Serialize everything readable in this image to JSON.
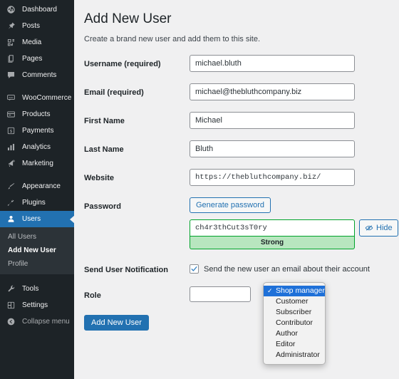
{
  "sidebar": {
    "items": [
      {
        "label": "Dashboard",
        "icon": "dashboard-icon",
        "current": false
      },
      {
        "label": "Posts",
        "icon": "pin-icon",
        "current": false
      },
      {
        "label": "Media",
        "icon": "media-icon",
        "current": false
      },
      {
        "label": "Pages",
        "icon": "pages-icon",
        "current": false
      },
      {
        "label": "Comments",
        "icon": "comments-icon",
        "current": false
      },
      {
        "label": "WooCommerce",
        "icon": "woocommerce-icon",
        "current": false
      },
      {
        "label": "Products",
        "icon": "products-icon",
        "current": false
      },
      {
        "label": "Payments",
        "icon": "payments-icon",
        "current": false
      },
      {
        "label": "Analytics",
        "icon": "analytics-icon",
        "current": false
      },
      {
        "label": "Marketing",
        "icon": "marketing-icon",
        "current": false
      },
      {
        "label": "Appearance",
        "icon": "appearance-icon",
        "current": false
      },
      {
        "label": "Plugins",
        "icon": "plugins-icon",
        "current": false
      },
      {
        "label": "Users",
        "icon": "users-icon",
        "current": true
      },
      {
        "label": "Tools",
        "icon": "tools-icon",
        "current": false
      },
      {
        "label": "Settings",
        "icon": "settings-icon",
        "current": false
      },
      {
        "label": "Collapse menu",
        "icon": "collapse-icon",
        "current": false
      }
    ],
    "submenu": [
      {
        "label": "All Users",
        "current": false
      },
      {
        "label": "Add New User",
        "current": true
      },
      {
        "label": "Profile",
        "current": false
      }
    ]
  },
  "page": {
    "title": "Add New User",
    "description": "Create a brand new user and add them to this site."
  },
  "form": {
    "username": {
      "label": "Username (required)",
      "value": "michael.bluth"
    },
    "email": {
      "label": "Email (required)",
      "value": "michael@thebluthcompany.biz"
    },
    "first_name": {
      "label": "First Name",
      "value": "Michael"
    },
    "last_name": {
      "label": "Last Name",
      "value": "Bluth"
    },
    "website": {
      "label": "Website",
      "value": "https://thebluthcompany.biz/"
    },
    "password": {
      "label": "Password",
      "generate_label": "Generate password",
      "value": "ch4r3thCut3sT0ry",
      "hide_label": "Hide",
      "strength": "Strong"
    },
    "notification": {
      "label": "Send User Notification",
      "checkbox_label": "Send the new user an email about their account",
      "checked": true
    },
    "role": {
      "label": "Role",
      "selected": "Shop manager",
      "options": [
        "Shop manager",
        "Customer",
        "Subscriber",
        "Contributor",
        "Author",
        "Editor",
        "Administrator"
      ]
    },
    "submit_label": "Add New User"
  },
  "colors": {
    "admin_blue": "#2271b1",
    "sidebar_bg": "#1d2327",
    "submenu_bg": "#2c3338",
    "strength_green": "#b8e6bf",
    "strength_border": "#00a32a",
    "select_highlight": "#1e70d8"
  }
}
